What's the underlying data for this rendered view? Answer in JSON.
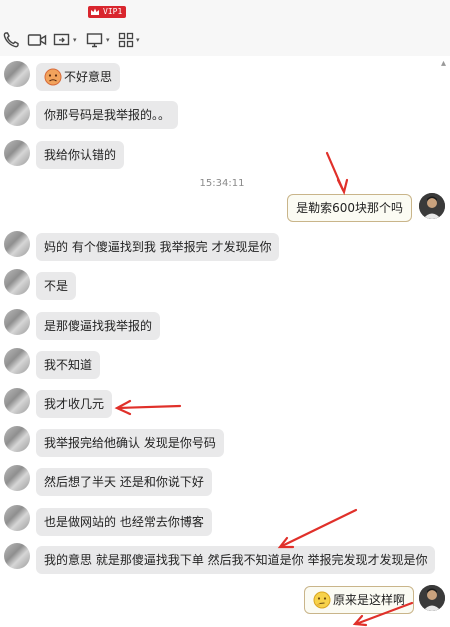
{
  "toolbar": {
    "vip_label": "VIP1",
    "tools": [
      {
        "name": "phone-icon"
      },
      {
        "name": "video-icon"
      },
      {
        "name": "share-screen-icon"
      },
      {
        "name": "remote-desktop-icon"
      },
      {
        "name": "apps-grid-icon"
      }
    ],
    "caret": "▾",
    "scroll_marker": "▴"
  },
  "messages": [
    {
      "side": "left",
      "text": "不好意思",
      "emoji": "sad-face"
    },
    {
      "side": "left",
      "text": "你那号码是我举报的。。"
    },
    {
      "side": "left",
      "text": "我给你认错的"
    },
    {
      "side": "time",
      "text": "15:34:11"
    },
    {
      "side": "right",
      "text": "是勒索600块那个吗"
    },
    {
      "side": "left",
      "text": "妈的 有个傻逼找到我 我举报完 才发现是你"
    },
    {
      "side": "left",
      "text": "不是"
    },
    {
      "side": "left",
      "text": "是那傻逼找我举报的"
    },
    {
      "side": "left",
      "text": "我不知道"
    },
    {
      "side": "left",
      "text": "我才收几元"
    },
    {
      "side": "left",
      "text": "我举报完给他确认 发现是你号码"
    },
    {
      "side": "left",
      "text": "然后想了半天 还是和你说下好"
    },
    {
      "side": "left",
      "text": "也是做网站的 也经常去你博客"
    },
    {
      "side": "left",
      "text": "我的意思 就是那傻逼找我下单 然后我不知道是你 举报完发现才发现是你"
    },
    {
      "side": "right",
      "text": "原来是这样啊",
      "emoji": "thinking-face"
    }
  ],
  "colors": {
    "annotation_arrow": "#e0302a",
    "bubble_left": "#e9e9ea",
    "bubble_right_border": "#c9b58a",
    "vip_badge": "#d9262e"
  }
}
